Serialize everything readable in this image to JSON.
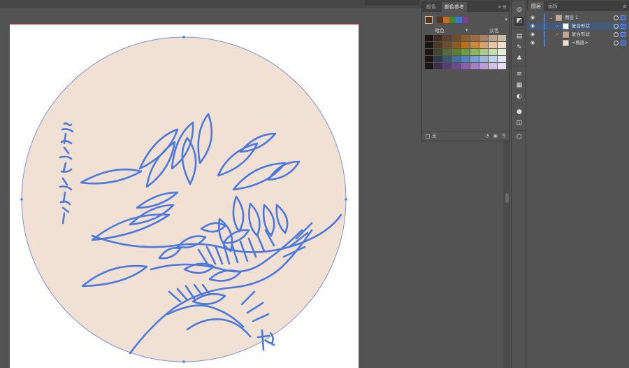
{
  "colors": {
    "workspace": "#535353",
    "artboard": "#ffffff",
    "circle_fill": "#f0e1d4",
    "line_art": "#4d78de",
    "accent_blue": "#4b79d6"
  },
  "color_guide": {
    "tabs": [
      {
        "label": "颜色",
        "active": false
      },
      {
        "label": "颜色参考",
        "active": true
      }
    ],
    "panel_controls": "»  ≡",
    "current_color": "#5a3212",
    "harmony_strip": [
      "#5a3212",
      "#c07024",
      "#3f8a2c",
      "#3d79c6",
      "#7c3f9c"
    ],
    "dropdown_icon": "chevron-down-icon",
    "label_dark": "暗色",
    "label_mid": "▾",
    "label_light": "淡色",
    "grid": [
      [
        "#1e1412",
        "#3e2f22",
        "#5a4330",
        "#6b4e2c",
        "#8c5e2a",
        "#9a6c3e",
        "#a98062",
        "#b9a38c",
        "#c9b9a8"
      ],
      [
        "#1e1412",
        "#4d3a26",
        "#6c4f2c",
        "#8c5e22",
        "#b5711c",
        "#c98c3e",
        "#d8a46c",
        "#e4c4a2",
        "#efe0cf"
      ],
      [
        "#1e1412",
        "#3e4630",
        "#566a38",
        "#5d7e34",
        "#6e9c40",
        "#8eb65e",
        "#acc986",
        "#c8dcb2",
        "#e1edd6"
      ],
      [
        "#1e1412",
        "#2e3a4a",
        "#3c5572",
        "#46709a",
        "#4f84c0",
        "#77a0d0",
        "#9cb8dc",
        "#c0d3ea",
        "#dfe8f4"
      ],
      [
        "#1e1412",
        "#3e2e4a",
        "#573e70",
        "#6c4c8c",
        "#8a5cac",
        "#a57cc2",
        "#bc9cd2",
        "#d4bfe2",
        "#e8dcf0"
      ]
    ],
    "footer_text": "无",
    "footer_icons": [
      "◔",
      "▣",
      "⎘"
    ]
  },
  "tools": [
    {
      "name": "color-wheel-icon",
      "glyph": "◎"
    },
    {
      "name": "color-guide-icon",
      "glyph": "◩",
      "active": true
    },
    {
      "name": "libraries-icon",
      "glyph": "▤"
    },
    {
      "name": "brushes-icon",
      "glyph": "✎"
    },
    {
      "name": "symbols-icon",
      "glyph": "♣"
    },
    {
      "name": "align-icon",
      "glyph": "≡"
    },
    {
      "name": "gradient-icon",
      "glyph": "▦"
    },
    {
      "name": "transparency-icon",
      "glyph": "◐"
    },
    {
      "name": "appearance-icon",
      "glyph": "●"
    },
    {
      "name": "graphic-styles-icon",
      "glyph": "◫"
    },
    {
      "name": "stroke-icon",
      "glyph": "⬡"
    }
  ],
  "layers": {
    "tabs": [
      {
        "label": "图层",
        "active": true
      },
      {
        "label": "画板",
        "active": false
      }
    ],
    "panel_menu": "≡",
    "rows": [
      {
        "label": "图层 1",
        "indent": 0,
        "selected": false,
        "expanded": true
      },
      {
        "label": "复合形状",
        "indent": 1,
        "selected": true,
        "expanded": false
      },
      {
        "label": "复合形状",
        "indent": 1,
        "selected": false,
        "expanded": false
      },
      {
        "label": "<椭圆>",
        "indent": 1,
        "selected": false,
        "expanded": false
      }
    ]
  }
}
